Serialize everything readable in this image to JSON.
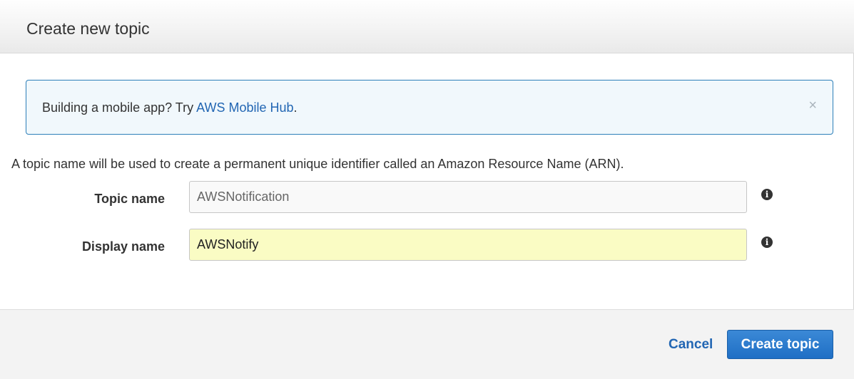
{
  "dialog": {
    "title": "Create new topic"
  },
  "alert": {
    "text_before": "Building a mobile app? Try ",
    "link_text": "AWS Mobile Hub",
    "text_after": ".",
    "close_glyph": "×"
  },
  "description": "A topic name will be used to create a permanent unique identifier called an Amazon Resource Name (ARN).",
  "fields": {
    "topic_name": {
      "label": "Topic name",
      "value": "AWSNotification",
      "info_glyph": "i"
    },
    "display_name": {
      "label": "Display name",
      "value": "AWSNotify",
      "info_glyph": "i"
    }
  },
  "footer": {
    "cancel_label": "Cancel",
    "create_label": "Create topic"
  },
  "colors": {
    "link": "#2266b3",
    "primary_button": "#2070c6",
    "alert_border": "#2d7fb9",
    "alert_background": "#f1f8fc",
    "active_input_background": "#fafcc4"
  }
}
